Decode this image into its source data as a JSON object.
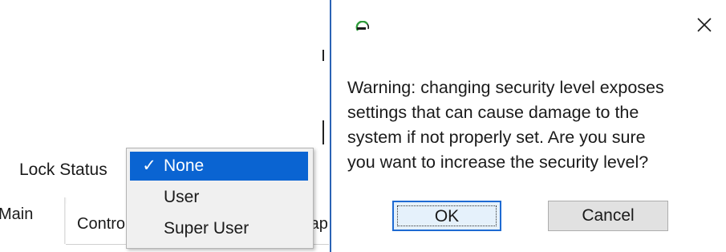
{
  "app": {
    "lock_status_label": "Lock Status",
    "tabs": [
      {
        "label": "Main"
      },
      {
        "label": "Control"
      },
      {
        "label": "Map"
      }
    ],
    "dropdown": {
      "selected": "None",
      "check_glyph": "✓",
      "items": [
        {
          "label": "None",
          "checked": true
        },
        {
          "label": "User",
          "checked": false
        },
        {
          "label": "Super User",
          "checked": false
        }
      ]
    }
  },
  "dialog": {
    "logo_icon": "app-logo-icon",
    "close_icon": "close-icon",
    "message_lines": [
      "Warning: changing security level exposes",
      "settings that can cause damage to the",
      "system if not properly set. Are you sure",
      "you want to increase the security level?"
    ],
    "ok_label": "OK",
    "cancel_label": "Cancel"
  },
  "colors": {
    "selection": "#0a64d2",
    "divider": "#2b63b5",
    "logo_arc": "#2e9b3a",
    "ok_border": "#1e6ad2"
  }
}
